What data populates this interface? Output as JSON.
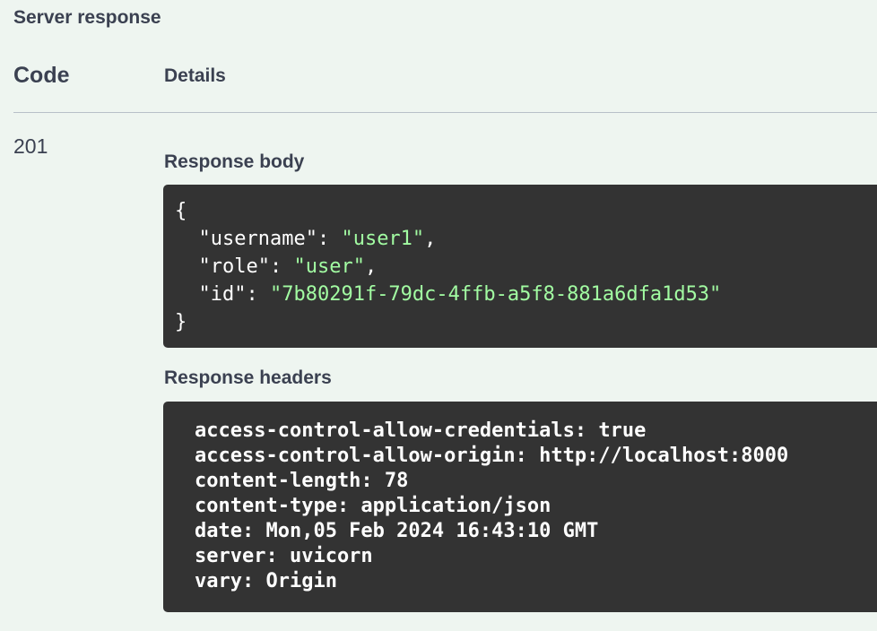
{
  "section_title": "Server response",
  "table": {
    "code_header": "Code",
    "details_header": "Details"
  },
  "response": {
    "status_code": "201",
    "body_heading": "Response body",
    "body": {
      "open": "{",
      "close": "}",
      "fields": [
        {
          "key": "\"username\"",
          "sep": ": ",
          "value": "\"user1\"",
          "trail": ","
        },
        {
          "key": "\"role\"",
          "sep": ": ",
          "value": "\"user\"",
          "trail": ","
        },
        {
          "key": "\"id\"",
          "sep": ": ",
          "value": "\"7b80291f-79dc-4ffb-a5f8-881a6dfa1d53\"",
          "trail": ""
        }
      ]
    },
    "headers_heading": "Response headers",
    "headers": [
      "access-control-allow-credentials: true",
      "access-control-allow-origin: http://localhost:8000",
      "content-length: 78",
      "content-type: application/json",
      "date: Mon,05 Feb 2024 16:43:10 GMT",
      "server: uvicorn",
      "vary: Origin"
    ]
  },
  "colors": {
    "background": "#eef5f0",
    "code_background": "#333333",
    "string_value": "#a2fca2",
    "heading_text": "#3b4151"
  }
}
